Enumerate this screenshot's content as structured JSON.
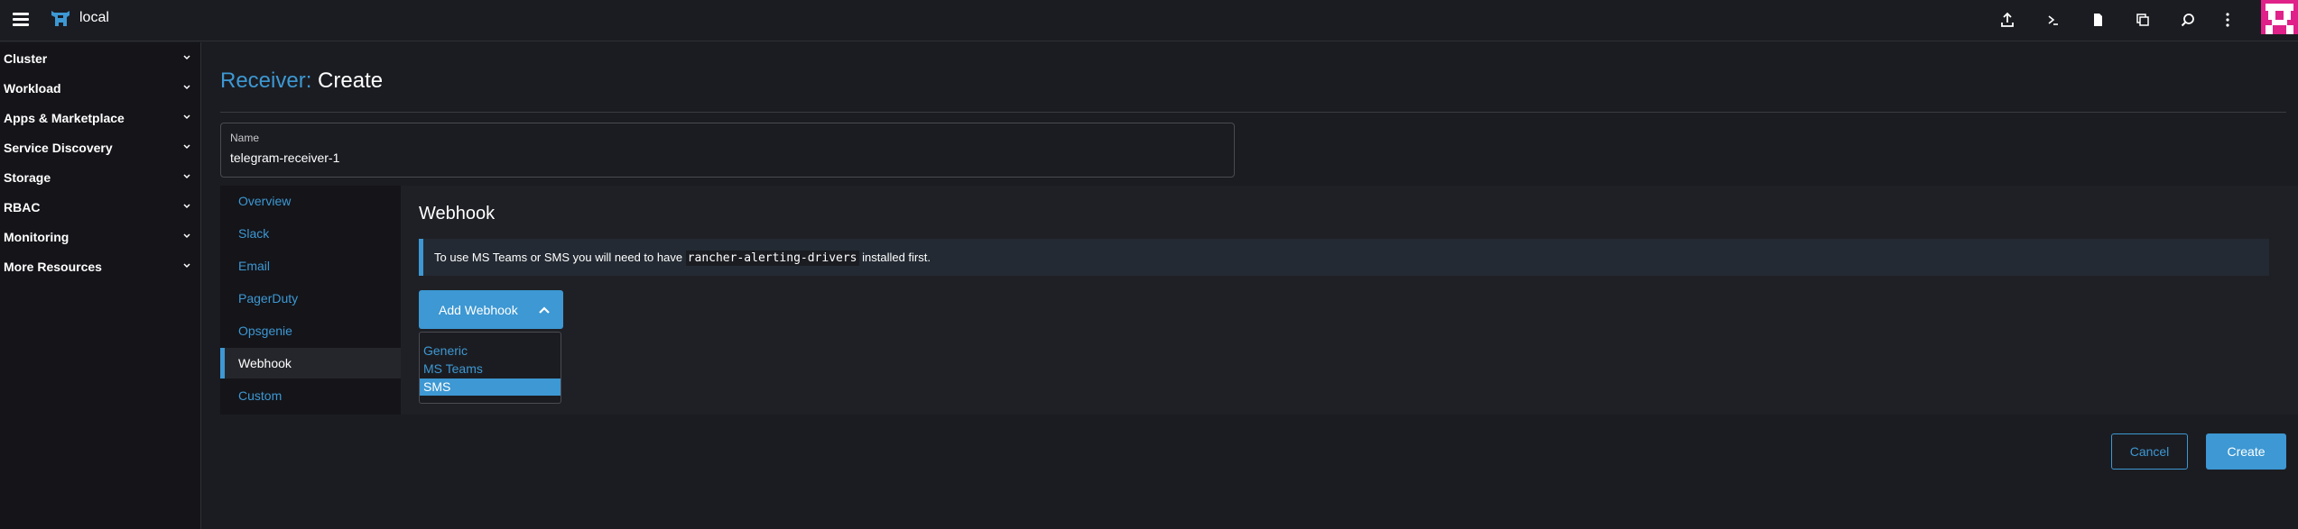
{
  "header": {
    "cluster_name": "local",
    "icons": [
      "import-yaml-icon",
      "kubectl-shell-icon",
      "kubeconfig-download-icon",
      "copy-kubeconfig-icon",
      "search-icon",
      "more-actions-icon"
    ]
  },
  "sidebar": {
    "items": [
      {
        "label": "Cluster"
      },
      {
        "label": "Workload"
      },
      {
        "label": "Apps & Marketplace"
      },
      {
        "label": "Service Discovery"
      },
      {
        "label": "Storage"
      },
      {
        "label": "RBAC"
      },
      {
        "label": "Monitoring"
      },
      {
        "label": "More Resources"
      }
    ]
  },
  "page": {
    "title_prefix": "Receiver:",
    "title_action": "Create",
    "name_label": "Name",
    "name_value": "telegram-receiver-1"
  },
  "tabs": [
    {
      "label": "Overview"
    },
    {
      "label": "Slack"
    },
    {
      "label": "Email"
    },
    {
      "label": "PagerDuty"
    },
    {
      "label": "Opsgenie"
    },
    {
      "label": "Webhook",
      "active": true
    },
    {
      "label": "Custom"
    }
  ],
  "webhook": {
    "section_title": "Webhook",
    "banner_before": "To use MS Teams or SMS you will need to have ",
    "banner_code": "rancher-alerting-drivers",
    "banner_after": " installed first.",
    "add_button_label": "Add Webhook",
    "dropdown_options": [
      "Generic",
      "MS Teams",
      "SMS"
    ],
    "selected_option": "SMS"
  },
  "footer": {
    "cancel_label": "Cancel",
    "create_label": "Create"
  },
  "colors": {
    "accent": "#3d98d3",
    "background": "#1b1c21",
    "sidebar_bg": "#141419",
    "avatar": "#e0218a"
  }
}
